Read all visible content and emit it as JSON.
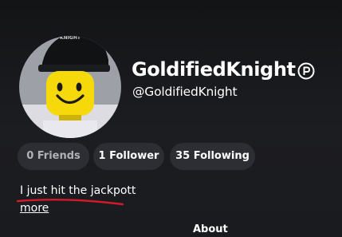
{
  "profile": {
    "display_name": "GoldifiedKnight",
    "handle": "@GoldifiedKnight",
    "premium_icon": "premium-badge-icon",
    "avatar_icon": "avatar-headshot"
  },
  "stats": {
    "friends_label": "0 Friends",
    "followers_label": "1 Follower",
    "following_label": "35 Following"
  },
  "bio": {
    "text": "I just hit the jackpott",
    "more_label": "more"
  },
  "tabs": {
    "about_label": "About"
  },
  "colors": {
    "background": "#1a1b1f",
    "pill_background": "#2c2e33",
    "avatar_face": "#f5d90a",
    "annotation_underline": "#d3192b"
  }
}
